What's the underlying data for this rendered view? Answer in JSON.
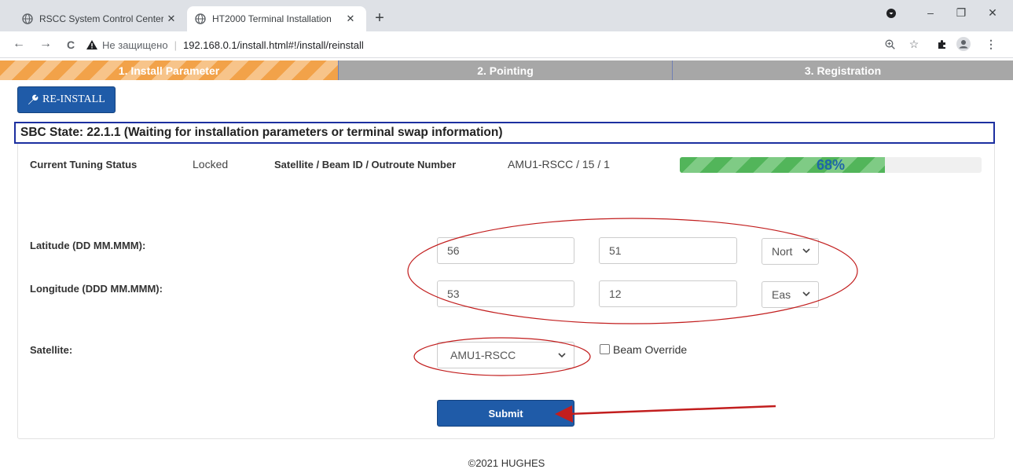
{
  "browser": {
    "tabs": [
      {
        "title": "RSCC System Control Center",
        "active": false
      },
      {
        "title": "HT2000 Terminal Installation",
        "active": true
      }
    ],
    "new_tab": "+",
    "window_controls": {
      "minimize": "–",
      "restore": "❐",
      "close": "✕"
    },
    "nav": {
      "back": "←",
      "forward": "→",
      "reload": "C"
    },
    "address": {
      "security_label": "Не защищено",
      "separator": "|",
      "url": "192.168.0.1/install.html#!/install/reinstall"
    },
    "toolbar_icons": [
      "zoom-icon",
      "star-icon",
      "extensions-icon",
      "profile-icon",
      "menu-icon"
    ]
  },
  "steps": [
    {
      "label": "1. Install Parameter",
      "state": "active"
    },
    {
      "label": "2. Pointing",
      "state": "inactive"
    },
    {
      "label": "3. Registration",
      "state": "inactive"
    }
  ],
  "reinstall_button": {
    "label": "RE-INSTALL",
    "icon": "wrench-icon"
  },
  "sbc_state": "SBC State: 22.1.1 (Waiting for installation parameters or terminal swap information)",
  "status": {
    "tuning_label": "Current Tuning Status",
    "tuning_value": "Locked",
    "satellite_label": "Satellite / Beam ID / Outroute Number",
    "satellite_value": "AMU1-RSCC / 15 / 1",
    "progress_percent": 68,
    "progress_text": "68%"
  },
  "form": {
    "latitude_label": "Latitude (DD MM.MMM):",
    "latitude_deg": "56",
    "latitude_min": "51",
    "latitude_dir": "Nort",
    "longitude_label": "Longitude (DDD MM.MMM):",
    "longitude_deg": "53",
    "longitude_min": "12",
    "longitude_dir": "Eas",
    "satellite_label": "Satellite:",
    "satellite_value": "AMU1-RSCC",
    "beam_override_label": "Beam Override",
    "beam_override_checked": false,
    "submit_label": "Submit"
  },
  "footer": "©2021 HUGHES",
  "colors": {
    "step_active": "#f2a249",
    "step_inactive": "#a7a7a7",
    "button_blue": "#1f5ba8",
    "state_border": "#1c2fa0",
    "progress_green": "#52b55a",
    "annotation_red": "#c21e1e"
  }
}
